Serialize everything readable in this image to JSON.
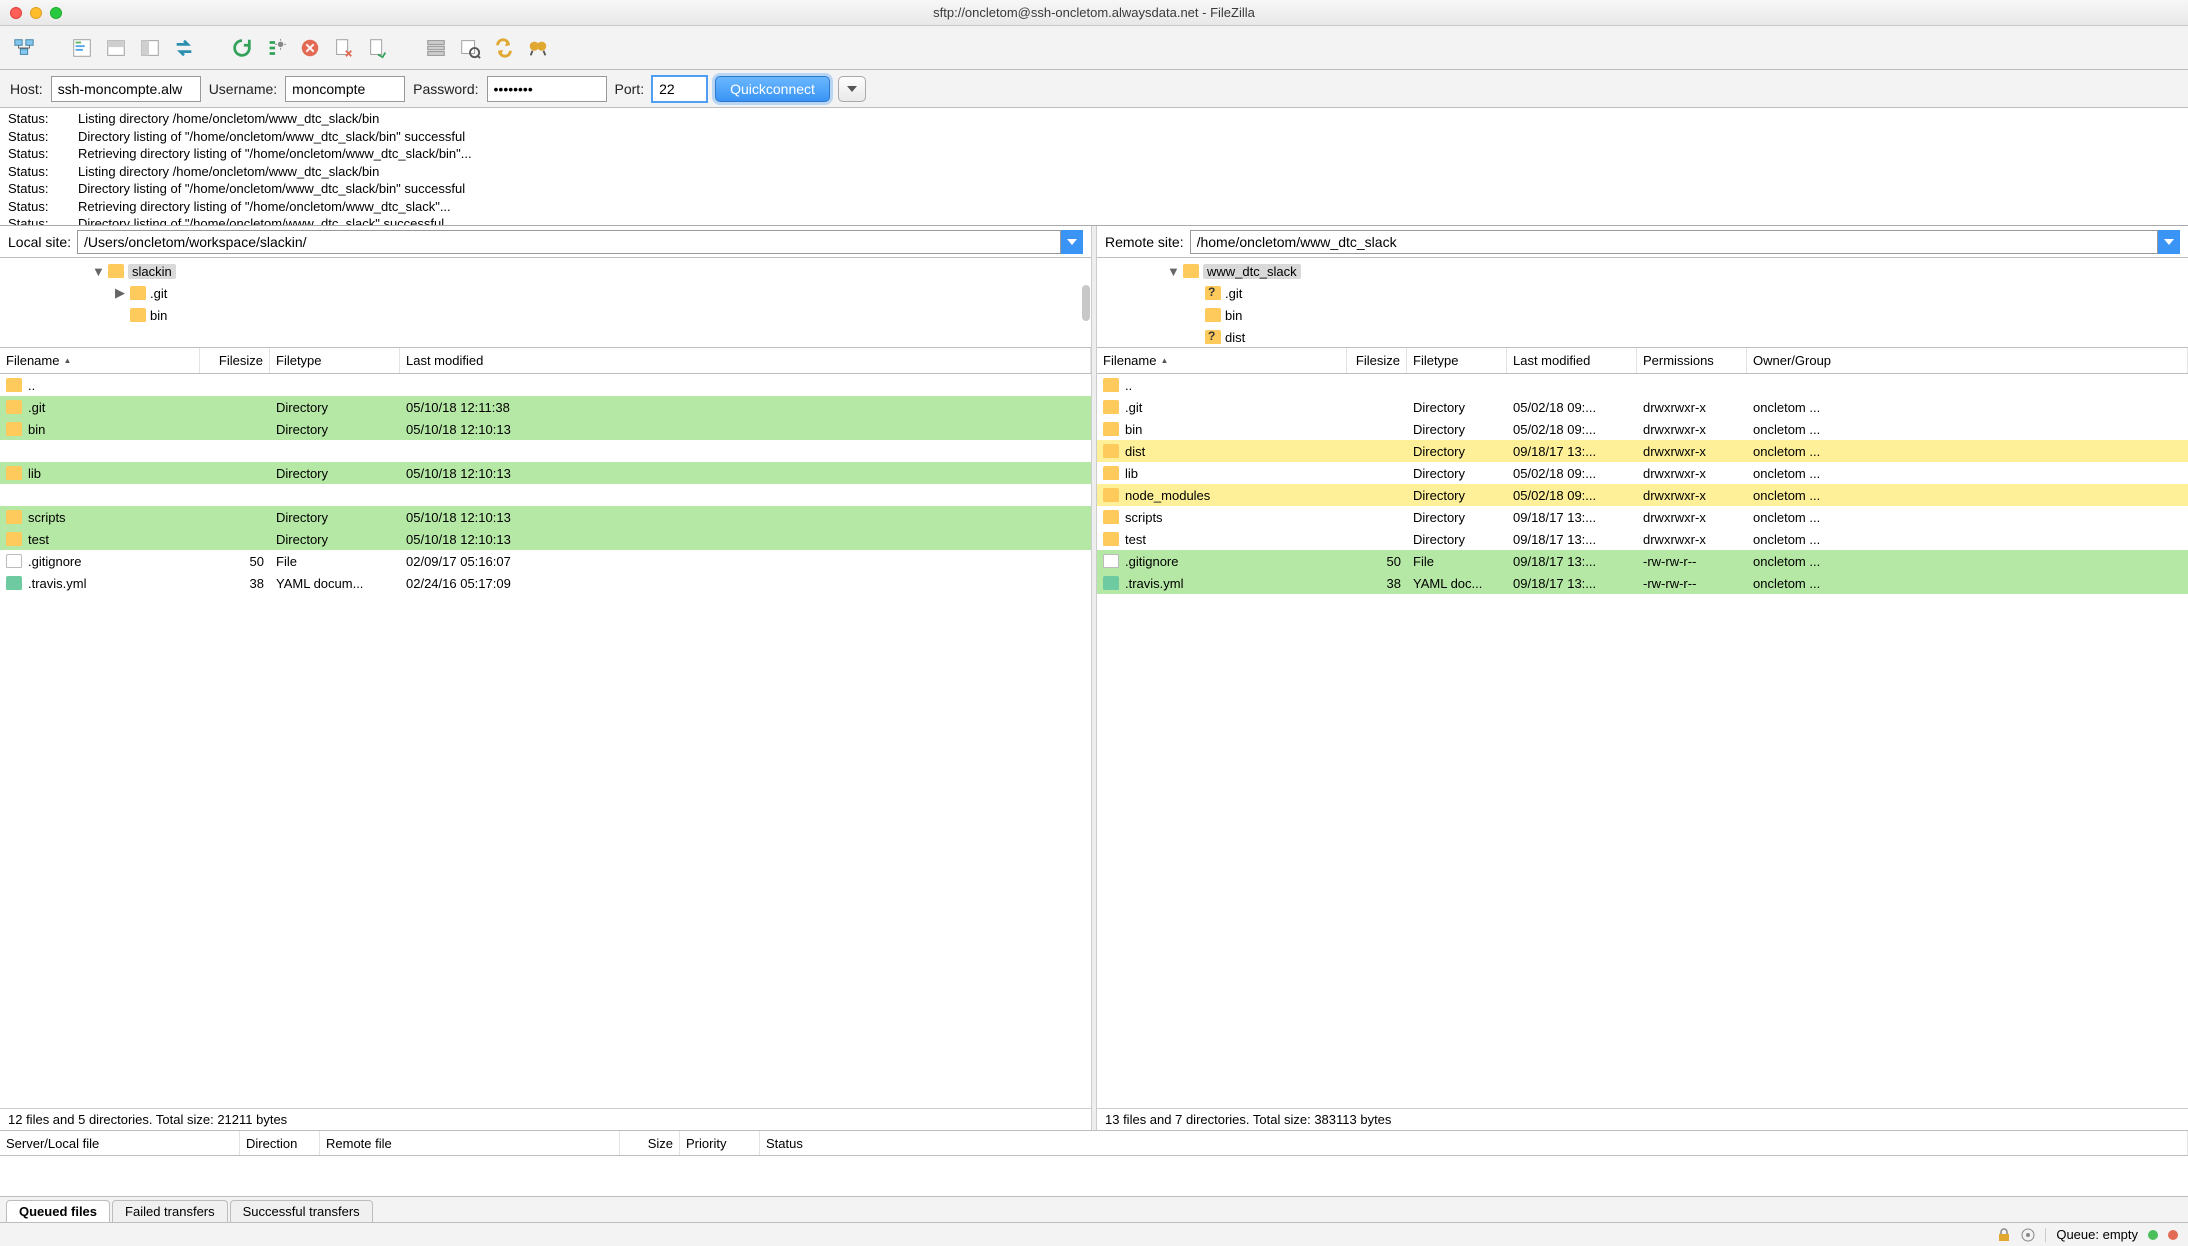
{
  "window": {
    "title": "sftp://oncletom@ssh-oncletom.alwaysdata.net - FileZilla"
  },
  "quickconnect": {
    "host_label": "Host:",
    "host_value": "ssh-moncompte.alw",
    "user_label": "Username:",
    "user_value": "moncompte",
    "pass_label": "Password:",
    "pass_value": "••••••••",
    "port_label": "Port:",
    "port_value": "22",
    "button": "Quickconnect"
  },
  "log": [
    {
      "lbl": "Status:",
      "msg": "Listing directory /home/oncletom/www_dtc_slack/bin"
    },
    {
      "lbl": "Status:",
      "msg": "Directory listing of \"/home/oncletom/www_dtc_slack/bin\" successful"
    },
    {
      "lbl": "Status:",
      "msg": "Retrieving directory listing of \"/home/oncletom/www_dtc_slack/bin\"..."
    },
    {
      "lbl": "Status:",
      "msg": "Listing directory /home/oncletom/www_dtc_slack/bin"
    },
    {
      "lbl": "Status:",
      "msg": "Directory listing of \"/home/oncletom/www_dtc_slack/bin\" successful"
    },
    {
      "lbl": "Status:",
      "msg": "Retrieving directory listing of \"/home/oncletom/www_dtc_slack\"..."
    },
    {
      "lbl": "Status:",
      "msg": "Directory listing of \"/home/oncletom/www_dtc_slack\" successful"
    }
  ],
  "local": {
    "site_label": "Local site:",
    "site_value": "/Users/oncletom/workspace/slackin/",
    "columns": [
      "Filename",
      "Filesize",
      "Filetype",
      "Last modified"
    ],
    "tree": [
      {
        "indent": 4,
        "arrow": "▼",
        "icon": "fold",
        "name": "slackin",
        "sel": true
      },
      {
        "indent": 5,
        "arrow": "▶",
        "icon": "fold",
        "name": ".git"
      },
      {
        "indent": 5,
        "arrow": "",
        "icon": "fold",
        "name": "bin"
      }
    ],
    "rows": [
      {
        "name": "..",
        "icon": "fold"
      },
      {
        "name": ".git",
        "icon": "fold",
        "ft": "Directory",
        "mod": "05/10/18 12:11:38",
        "hl": "green"
      },
      {
        "name": "bin",
        "icon": "fold",
        "ft": "Directory",
        "mod": "05/10/18 12:10:13",
        "hl": "green"
      },
      {
        "blank": true
      },
      {
        "name": "lib",
        "icon": "fold",
        "ft": "Directory",
        "mod": "05/10/18 12:10:13",
        "hl": "green"
      },
      {
        "blank": true
      },
      {
        "name": "scripts",
        "icon": "fold",
        "ft": "Directory",
        "mod": "05/10/18 12:10:13",
        "hl": "green"
      },
      {
        "name": "test",
        "icon": "fold",
        "ft": "Directory",
        "mod": "05/10/18 12:10:13",
        "hl": "green"
      },
      {
        "name": ".gitignore",
        "icon": "file",
        "size": "50",
        "ft": "File",
        "mod": "02/09/17 05:16:07"
      },
      {
        "name": ".travis.yml",
        "icon": "yaml",
        "size": "38",
        "ft": "YAML docum...",
        "mod": "02/24/16 05:17:09"
      }
    ],
    "summary": "12 files and 5 directories. Total size: 21211 bytes"
  },
  "remote": {
    "site_label": "Remote site:",
    "site_value": "/home/oncletom/www_dtc_slack",
    "columns": [
      "Filename",
      "Filesize",
      "Filetype",
      "Last modified",
      "Permissions",
      "Owner/Group"
    ],
    "tree": [
      {
        "indent": 3,
        "arrow": "▼",
        "icon": "fold",
        "name": "www_dtc_slack",
        "sel": true
      },
      {
        "indent": 4,
        "arrow": "",
        "icon": "foldq",
        "name": ".git"
      },
      {
        "indent": 4,
        "arrow": "",
        "icon": "fold",
        "name": "bin"
      },
      {
        "indent": 4,
        "arrow": "",
        "icon": "foldq",
        "name": "dist"
      }
    ],
    "rows": [
      {
        "name": "..",
        "icon": "fold"
      },
      {
        "name": ".git",
        "icon": "fold",
        "ft": "Directory",
        "mod": "05/02/18 09:...",
        "perm": "drwxrwxr-x",
        "own": "oncletom ..."
      },
      {
        "name": "bin",
        "icon": "fold",
        "ft": "Directory",
        "mod": "05/02/18 09:...",
        "perm": "drwxrwxr-x",
        "own": "oncletom ..."
      },
      {
        "name": "dist",
        "icon": "fold",
        "ft": "Directory",
        "mod": "09/18/17 13:...",
        "perm": "drwxrwxr-x",
        "own": "oncletom ...",
        "hl": "yellow"
      },
      {
        "name": "lib",
        "icon": "fold",
        "ft": "Directory",
        "mod": "05/02/18 09:...",
        "perm": "drwxrwxr-x",
        "own": "oncletom ..."
      },
      {
        "name": "node_modules",
        "icon": "fold",
        "ft": "Directory",
        "mod": "05/02/18 09:...",
        "perm": "drwxrwxr-x",
        "own": "oncletom ...",
        "hl": "yellow"
      },
      {
        "name": "scripts",
        "icon": "fold",
        "ft": "Directory",
        "mod": "09/18/17 13:...",
        "perm": "drwxrwxr-x",
        "own": "oncletom ..."
      },
      {
        "name": "test",
        "icon": "fold",
        "ft": "Directory",
        "mod": "09/18/17 13:...",
        "perm": "drwxrwxr-x",
        "own": "oncletom ..."
      },
      {
        "name": ".gitignore",
        "icon": "file",
        "size": "50",
        "ft": "File",
        "mod": "09/18/17 13:...",
        "perm": "-rw-rw-r--",
        "own": "oncletom ...",
        "hl": "green"
      },
      {
        "name": ".travis.yml",
        "icon": "yaml",
        "size": "38",
        "ft": "YAML doc...",
        "mod": "09/18/17 13:...",
        "perm": "-rw-rw-r--",
        "own": "oncletom ...",
        "hl": "green"
      }
    ],
    "summary": "13 files and 7 directories. Total size: 383113 bytes"
  },
  "queue": {
    "columns": [
      "Server/Local file",
      "Direction",
      "Remote file",
      "Size",
      "Priority",
      "Status"
    ],
    "tabs": [
      "Queued files",
      "Failed transfers",
      "Successful transfers"
    ]
  },
  "statusbar": {
    "queue_label": "Queue: empty"
  }
}
